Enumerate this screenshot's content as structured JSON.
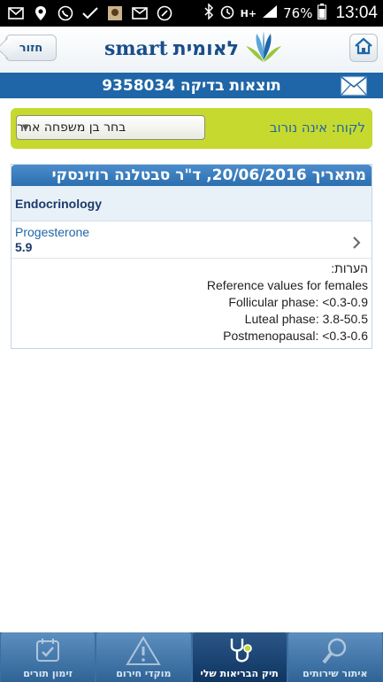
{
  "status_bar": {
    "network": "H+",
    "battery": "76%",
    "time": "13:04",
    "icons": [
      "mail-icon",
      "location-icon",
      "whatsapp-icon",
      "check-icon",
      "app-icon",
      "gmail-icon",
      "call-icon",
      "bluetooth-icon",
      "alarm-icon",
      "signal-icon",
      "battery-icon"
    ]
  },
  "header": {
    "back_label": "חזור",
    "logo_text": "smart",
    "logo_hebrew": "לאומית",
    "home_icon": "home-icon"
  },
  "title_bar": {
    "title": "תוצאות בדיקה 9358034",
    "mail_icon": "envelope-icon"
  },
  "patient": {
    "label": "לקוח:",
    "name": "אינה נורוב",
    "select_value": "בחר בן משפחה אחר"
  },
  "result": {
    "header": "מתאריך 20/06/2016, ד\"ר סבטלנה רוזינסקי",
    "department": "Endocrinology",
    "test_name": "Progesterone",
    "test_value": "5.9",
    "notes_label": "הערות:",
    "notes": [
      "Reference values for females",
      "Follicular phase: <0.3-0.9",
      "Luteal phase: 3.8-50.5",
      "Postmenopausal: <0.3-0.6"
    ]
  },
  "bottom_nav": {
    "tabs": [
      {
        "label": "זימון תורים",
        "icon": "calendar-icon"
      },
      {
        "label": "מוקדי חירום",
        "icon": "warning-icon"
      },
      {
        "label": "תיק הבריאות שלי",
        "icon": "stethoscope-icon"
      },
      {
        "label": "איתור שירותים",
        "icon": "magnifier-icon"
      }
    ],
    "active_index": 2
  },
  "colors": {
    "brand_blue": "#1f66a8",
    "patient_bar": "#c6d92f",
    "nav_bg": "#3a6fa3"
  }
}
